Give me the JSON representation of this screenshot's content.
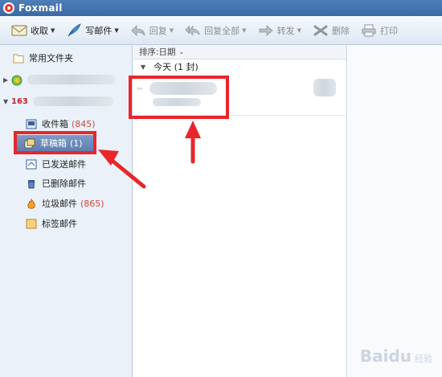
{
  "window": {
    "title": "Foxmail"
  },
  "toolbar": {
    "buttons": [
      {
        "label": "收取",
        "icon": "envelope-icon",
        "dropdown": true,
        "enabled": true
      },
      {
        "label": "写邮件",
        "icon": "feather-pen-icon",
        "dropdown": true,
        "enabled": true
      },
      {
        "label": "回复",
        "icon": "reply-icon",
        "dropdown": true,
        "enabled": false
      },
      {
        "label": "回复全部",
        "icon": "reply-all-icon",
        "dropdown": true,
        "enabled": false
      },
      {
        "label": "转发",
        "icon": "forward-icon",
        "dropdown": true,
        "enabled": false
      },
      {
        "label": "删除",
        "icon": "delete-icon",
        "dropdown": false,
        "enabled": false
      },
      {
        "label": "打印",
        "icon": "printer-icon",
        "dropdown": false,
        "enabled": false
      }
    ]
  },
  "sidebar": {
    "common_folder": "常用文件夹",
    "account_badge": "163",
    "folders": [
      {
        "label": "收件箱",
        "count": "(845)",
        "icon": "inbox-icon"
      },
      {
        "label": "草稿箱",
        "count": "(1)",
        "icon": "drafts-icon",
        "selected": true
      },
      {
        "label": "已发送邮件",
        "count": "",
        "icon": "sent-icon"
      },
      {
        "label": "已删除邮件",
        "count": "",
        "icon": "trash-icon"
      },
      {
        "label": "垃圾邮件",
        "count": "(865)",
        "icon": "junk-fire-icon"
      },
      {
        "label": "标签邮件",
        "count": "",
        "icon": "tag-folder-icon"
      }
    ]
  },
  "message_list": {
    "sort_label": "排序:日期",
    "group_label": "今天 (1 封)"
  },
  "watermark": {
    "brand": "Baidu",
    "sub": "经验"
  },
  "colors": {
    "highlight_red": "#e8262b",
    "count_red": "#d0463c",
    "selected_bg": "#6a89b9",
    "title_blue": "#3a6aa3"
  }
}
